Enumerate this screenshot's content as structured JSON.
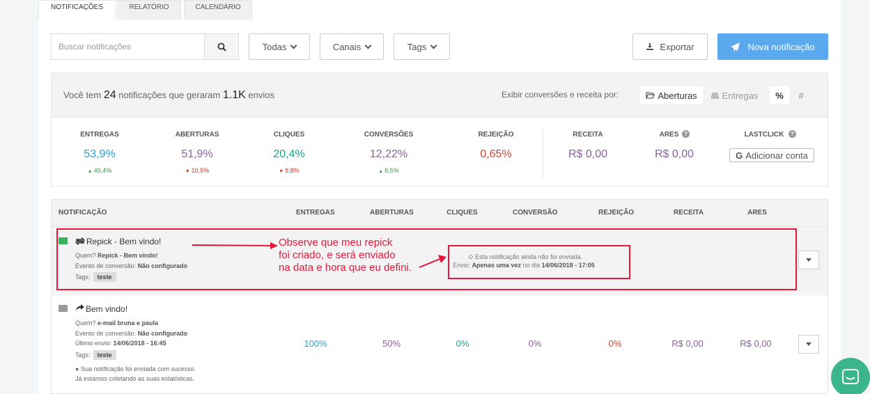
{
  "tabs": [
    {
      "label": "NOTIFICAÇÕES"
    },
    {
      "label": "RELATÓRIO"
    },
    {
      "label": "CALENDÁRIO"
    }
  ],
  "toolbar": {
    "search_placeholder": "Buscar notificações",
    "filters": [
      {
        "label": "Todas"
      },
      {
        "label": "Canais"
      },
      {
        "label": "Tags"
      }
    ],
    "export_label": "Exportar",
    "new_label": "Nova notificação"
  },
  "summary": {
    "prefix": "Você tem",
    "count": "24",
    "middle": "notificações que geraram",
    "sends": "1.1K",
    "suffix": "envios",
    "show_by_label": "Exibir conversões e receita por:",
    "opens_label": "Aberturas",
    "deliveries_label": "Entregas",
    "percent_symbol": "%",
    "hash_symbol": "#",
    "stats": [
      {
        "label": "ENTREGAS",
        "value": "53,9%",
        "delta": "49,4%",
        "color": "#2a9fd6"
      },
      {
        "label": "ABERTURAS",
        "value": "51,9%",
        "delta": "10,5%",
        "color": "#8e5ea2"
      },
      {
        "label": "CLIQUES",
        "value": "20,4%",
        "delta": "9,8%",
        "color": "#1aa38a"
      },
      {
        "label": "CONVERSÕES",
        "value": "12,22%",
        "delta": "8,5%",
        "color": "#8e5ea2"
      },
      {
        "label": "REJEIÇÃO",
        "value": "0,65%",
        "color": "#d9412f"
      }
    ],
    "revenue": {
      "label": "RECEITA",
      "value": "R$ 0,00"
    },
    "ares": {
      "label": "ARES",
      "value": "R$ 0,00"
    },
    "lastclick": {
      "label": "LASTCLICK",
      "button": "Adicionar conta"
    }
  },
  "table": {
    "headers": [
      "NOTIFICAÇÃO",
      "ENTREGAS",
      "ABERTURAS",
      "CLIQUES",
      "CONVERSÃO",
      "REJEIÇÃO",
      "RECEITA",
      "ARES"
    ],
    "rows": [
      {
        "title": "Repick - Bem vindo!",
        "who_label": "Quem?",
        "who": "Repick - Bem vindo!",
        "conv_label": "Evento de conversão:",
        "conv": "Não configurado",
        "tags_label": "Tags:",
        "tag": "teste",
        "status_line1": "Esta notificação ainda não foi enviada.",
        "status_prefix": "Envio:",
        "status_freq": "Apenas uma vez",
        "status_mid": "no dia",
        "status_date": "14/06/2018 - 17:05"
      },
      {
        "title": "Bem vindo!",
        "who_label": "Quem?",
        "who": "e-mail bruna e paula",
        "conv_label": "Evento de conversão:",
        "conv": "Não configurado",
        "last_label": "Último envio:",
        "last": "14/06/2018 - 16:45",
        "tags_label": "Tags:",
        "tag": "teste",
        "info1": "Sua notificação foi enviada com sucesso.",
        "info2": "Já estamos coletando as suas estatísticas.",
        "deliveries": "100%",
        "opens": "50%",
        "clicks": "0%",
        "conversion": "0%",
        "rejection": "0%",
        "revenue": "R$ 0,00",
        "ares": "R$ 0,00"
      }
    ]
  },
  "annotation": {
    "line1": "Observe que meu repick",
    "line2": "foi criado, e será enviado",
    "line3": "na data e hora que eu defini."
  },
  "colors": {
    "primary": "#5aa9ee",
    "annotation": "#e8173a",
    "chat": "#3bb58a"
  }
}
